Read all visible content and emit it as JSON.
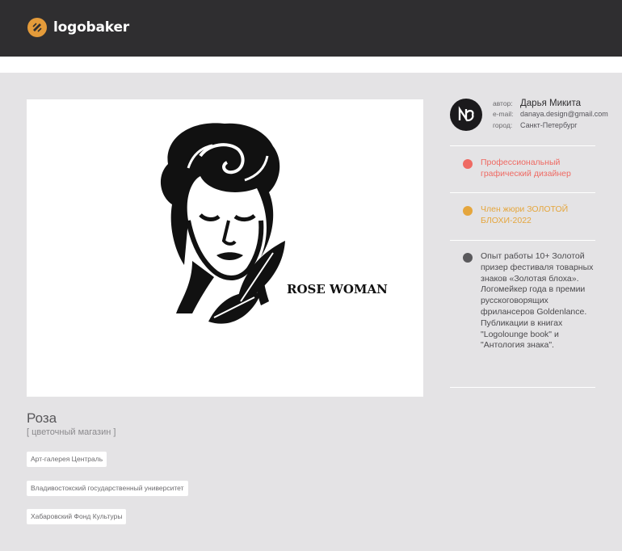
{
  "header": {
    "brand": "logobaker",
    "accent": "#e49b3a",
    "bg": "#2f2e30"
  },
  "work": {
    "title": "Роза",
    "subtitle": "[ цветочный магазин ]",
    "image_caption": "ROSE WOMAN",
    "tags": [
      "Арт-галерея Централь",
      "Владивостокский государственный университет",
      "Хабаровский Фонд Культуры"
    ]
  },
  "author": {
    "name_label": "автор:",
    "name": "Дарья Микита",
    "email_label": "e-mail:",
    "email": "danaya.design@gmail.com",
    "city_label": "город:",
    "city": "Санкт-Петербург"
  },
  "achievements": [
    {
      "icon": "flame-icon",
      "color": "#ef6a63",
      "text": "Профессиональный графический дизайнер"
    },
    {
      "icon": "star-icon",
      "color": "#e5a63d",
      "text": "Член жюри ЗОЛОТОЙ БЛОХИ-2022"
    },
    {
      "icon": "list-icon",
      "color": "#5a595c",
      "text": "Опыт работы 10+ Золотой призер фестиваля товарных знаков «Золотая блоха». Логомейкер года в премии русскоговорящих фрилансеров Goldenlance. Публикации в книгах \"Logolounge book\" и \"Антология знака\"."
    }
  ]
}
